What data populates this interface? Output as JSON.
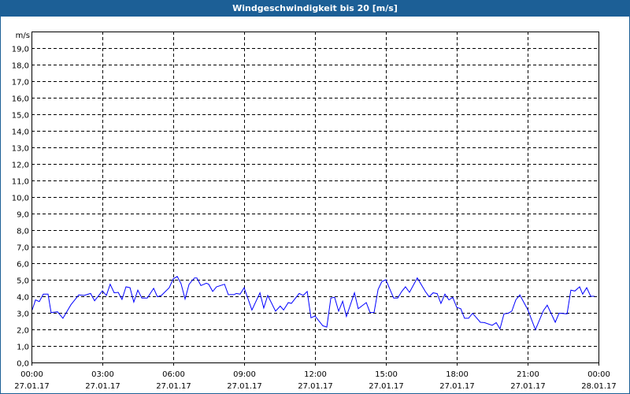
{
  "window": {
    "title": "Windgeschwindigkeit bis 20 [m/s]"
  },
  "colors": {
    "titlebar": "#1c5f96",
    "line": "#0000ff",
    "grid": "#000000"
  },
  "chart_data": {
    "type": "line",
    "title": "Windgeschwindigkeit bis 20 [m/s]",
    "ylabel": "m/s",
    "xlabel": "",
    "ylim": [
      0,
      20
    ],
    "xlim_hours": [
      0,
      24
    ],
    "grid": true,
    "y_ticks": [
      "0,0",
      "1,0",
      "2,0",
      "3,0",
      "4,0",
      "5,0",
      "6,0",
      "7,0",
      "8,0",
      "9,0",
      "10,0",
      "11,0",
      "12,0",
      "13,0",
      "14,0",
      "15,0",
      "16,0",
      "17,0",
      "18,0",
      "19,0"
    ],
    "x_ticks": [
      {
        "time": "00:00",
        "date": "27.01.17"
      },
      {
        "time": "03:00",
        "date": "27.01.17"
      },
      {
        "time": "06:00",
        "date": "27.01.17"
      },
      {
        "time": "09:00",
        "date": "27.01.17"
      },
      {
        "time": "12:00",
        "date": "27.01.17"
      },
      {
        "time": "15:00",
        "date": "27.01.17"
      },
      {
        "time": "18:00",
        "date": "27.01.17"
      },
      {
        "time": "21:00",
        "date": "27.01.17"
      },
      {
        "time": "00:00",
        "date": "28.01.17"
      }
    ],
    "series": [
      {
        "name": "Windgeschwindigkeit",
        "x_hours": [
          0.03,
          0.17,
          0.33,
          0.5,
          0.7,
          0.83,
          1.1,
          1.33,
          1.67,
          2,
          2.23,
          2.5,
          2.67,
          3,
          3.17,
          3.33,
          3.5,
          3.67,
          3.83,
          4,
          4.17,
          4.33,
          4.5,
          4.67,
          4.9,
          5.17,
          5.33,
          5.5,
          5.83,
          6,
          6.17,
          6.33,
          6.5,
          6.67,
          6.9,
          7,
          7.17,
          7.4,
          7.5,
          7.67,
          7.83,
          8.17,
          8.33,
          8.57,
          8.67,
          8.83,
          9,
          9.33,
          9.67,
          9.83,
          10,
          10.33,
          10.53,
          10.67,
          10.87,
          11,
          11.33,
          11.5,
          11.67,
          11.83,
          12,
          12.33,
          12.5,
          12.67,
          12.83,
          13,
          13.17,
          13.33,
          13.67,
          13.83,
          14.17,
          14.33,
          14.5,
          14.67,
          14.83,
          15,
          15.33,
          15.5,
          15.67,
          15.83,
          16,
          16.33,
          16.67,
          16.83,
          17,
          17.17,
          17.33,
          17.5,
          17.67,
          17.83,
          18,
          18.17,
          18.33,
          18.5,
          18.67,
          19,
          19.17,
          19.5,
          19.67,
          19.83,
          20,
          20.17,
          20.33,
          20.5,
          20.67,
          21,
          21.33,
          21.67,
          21.83,
          22.17,
          22.33,
          22.67,
          22.83,
          23,
          23.2,
          23.33,
          23.5,
          23.67,
          23.83
        ],
        "values": [
          3.17,
          3.78,
          3.68,
          4.13,
          4.13,
          3.02,
          3.06,
          2.67,
          3.49,
          4.08,
          4.05,
          4.17,
          3.73,
          4.33,
          4.05,
          4.73,
          4.21,
          4.24,
          3.81,
          4.57,
          4.52,
          3.65,
          4.37,
          3.89,
          3.89,
          4.48,
          3.97,
          4.05,
          4.52,
          5.05,
          5.2,
          4.76,
          3.84,
          4.73,
          5.11,
          5.11,
          4.65,
          4.79,
          4.73,
          4.29,
          4.57,
          4.73,
          4.1,
          4.1,
          4.17,
          4.13,
          4.52,
          3.17,
          4.21,
          3.29,
          4.05,
          3.1,
          3.41,
          3.17,
          3.62,
          3.57,
          4.17,
          4.05,
          4.29,
          2.7,
          2.81,
          2.22,
          2.14,
          3.89,
          3.94,
          3.1,
          3.7,
          2.78,
          4.21,
          3.25,
          3.62,
          3.02,
          3.02,
          4.41,
          4.89,
          5.0,
          3.89,
          3.89,
          4.29,
          4.57,
          4.24,
          5.11,
          4.29,
          3.97,
          4.21,
          4.16,
          3.57,
          4.13,
          3.78,
          3.94,
          3.33,
          3.25,
          2.67,
          2.67,
          2.97,
          2.43,
          2.41,
          2.25,
          2.41,
          2.03,
          2.94,
          2.97,
          3.1,
          3.78,
          4.08,
          3.21,
          1.98,
          3.14,
          3.46,
          2.43,
          2.98,
          2.94,
          4.37,
          4.32,
          4.57,
          4.13,
          4.52,
          4.0,
          4.0
        ]
      }
    ]
  }
}
